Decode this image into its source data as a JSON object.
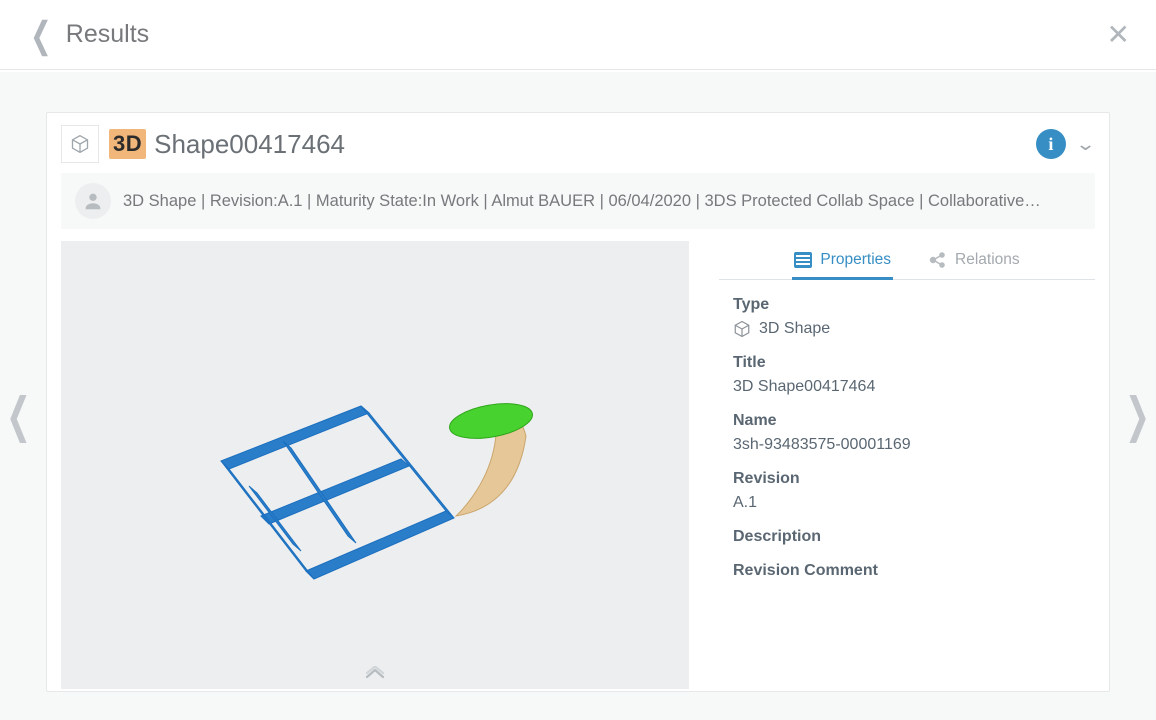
{
  "page": {
    "title": "Results"
  },
  "item": {
    "badge": "3D",
    "title": "Shape00417464",
    "subheader": "3D Shape | Revision:A.1 | Maturity State:In Work | Almut BAUER | 06/04/2020 | 3DS Protected Collab Space | Collaborative…"
  },
  "tabs": {
    "properties": "Properties",
    "relations": "Relations"
  },
  "props": {
    "type_label": "Type",
    "type_value": "3D Shape",
    "title_label": "Title",
    "title_value": "3D Shape00417464",
    "name_label": "Name",
    "name_value": "3sh-93483575-00001169",
    "revision_label": "Revision",
    "revision_value": "A.1",
    "description_label": "Description",
    "revcomment_label": "Revision Comment"
  }
}
